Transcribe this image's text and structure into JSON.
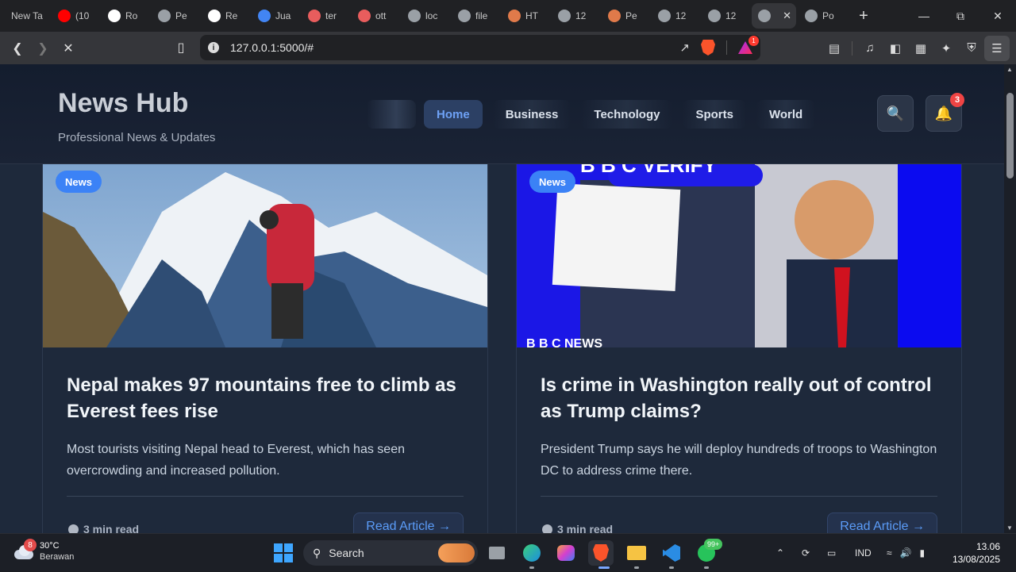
{
  "browser": {
    "tabs": [
      {
        "label": "New Ta",
        "color": "#5f6368",
        "icon": "brave-icon"
      },
      {
        "label": "(10",
        "color": "#ff0000",
        "icon": "youtube-icon"
      },
      {
        "label": "Ro",
        "color": "#ffffff",
        "icon": "roblox-icon"
      },
      {
        "label": "Pe",
        "color": "#9aa0a6",
        "icon": "perplexity-icon"
      },
      {
        "label": "Re",
        "color": "#ffffff",
        "icon": "medium-icon"
      },
      {
        "label": "Jua",
        "color": "#4285f4",
        "icon": "google-icon"
      },
      {
        "label": "ter",
        "color": "#e85d5d",
        "icon": "shield-icon"
      },
      {
        "label": "ott",
        "color": "#e85d5d",
        "icon": "shield-icon"
      },
      {
        "label": "loc",
        "color": "#9aa0a6",
        "icon": "mountain-icon"
      },
      {
        "label": "file",
        "color": "#9aa0a6",
        "icon": "globe-icon"
      },
      {
        "label": "HT",
        "color": "#e07a4a",
        "icon": "claude-icon"
      },
      {
        "label": "12",
        "color": "#9aa0a6",
        "icon": "globe-icon"
      },
      {
        "label": "Pe",
        "color": "#e07a4a",
        "icon": "claude-icon"
      },
      {
        "label": "12",
        "color": "#9aa0a6",
        "icon": "globe-icon"
      },
      {
        "label": "12",
        "color": "#9aa0a6",
        "icon": "globe-icon"
      },
      {
        "label": "",
        "color": "#9aa0a6",
        "icon": "loading-icon",
        "active": true
      },
      {
        "label": "Po",
        "color": "#9aa0a6",
        "icon": "globe-icon"
      }
    ],
    "url": "127.0.0.1:5000/#",
    "rewards_badge": "1"
  },
  "site": {
    "title": "News Hub",
    "subtitle": "Professional News & Updates",
    "nav": [
      "Home",
      "Business",
      "Technology",
      "Sports",
      "World"
    ],
    "search_icon": "🔍",
    "bell_icon": "🔔",
    "notification_count": "3"
  },
  "articles": [
    {
      "tag": "News",
      "title": "Nepal makes 97 mountains free to climb as Everest fees rise",
      "description": "Most tourists visiting Nepal head to Everest, which has seen overcrowding and increased pollution.",
      "read_time": "3 min read",
      "cta": "Read Article →"
    },
    {
      "tag": "News",
      "title": "Is crime in Washington really out of control as Trump claims?",
      "description": "President Trump says he will deploy hundreds of troops to Washington DC to address crime there.",
      "read_time": "3 min read",
      "cta": "Read Article →",
      "image_text_top": "B B C VERIFY",
      "image_text_bottom": "B B C NEWS"
    }
  ],
  "taskbar": {
    "weather_temp": "30°C",
    "weather_cond": "Berawan",
    "weather_badge": "8",
    "search_label": "Search",
    "whatsapp_badge": "99+",
    "language": "IND",
    "time": "13.06",
    "date": "13/08/2025"
  }
}
